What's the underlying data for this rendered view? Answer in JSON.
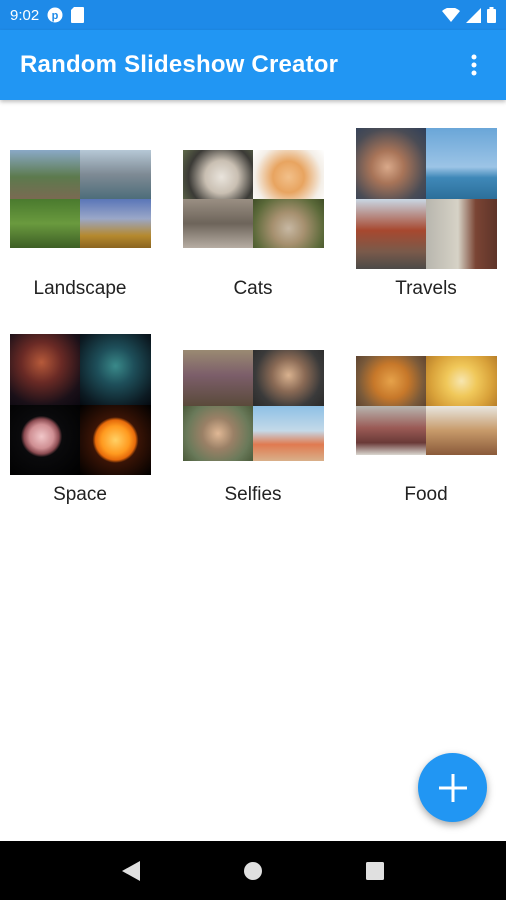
{
  "status_bar": {
    "time": "9:02",
    "icons": [
      "podcast-icon",
      "sd-card-icon",
      "wifi-icon",
      "signal-icon",
      "battery-icon"
    ]
  },
  "app_bar": {
    "title": "Random Slideshow Creator",
    "menu_icon": "more-vert-icon"
  },
  "albums": [
    {
      "name": "Landscape"
    },
    {
      "name": "Cats"
    },
    {
      "name": "Travels"
    },
    {
      "name": "Space"
    },
    {
      "name": "Selfies"
    },
    {
      "name": "Food"
    }
  ],
  "fab": {
    "icon": "plus-icon"
  },
  "nav": {
    "icons": [
      "back-icon",
      "home-icon",
      "recents-icon"
    ]
  },
  "colors": {
    "primary": "#2196f3",
    "status": "#1e8ae8",
    "nav": "#000000"
  }
}
